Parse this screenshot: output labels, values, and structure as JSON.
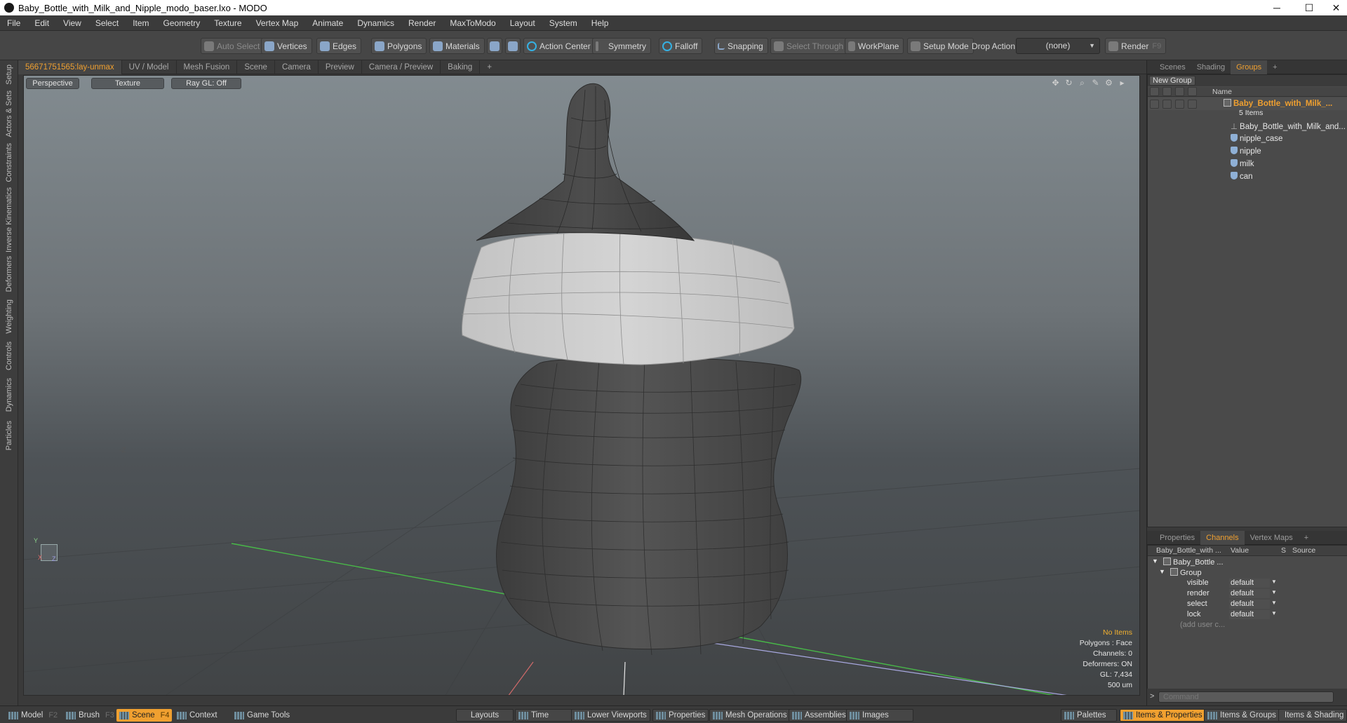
{
  "window": {
    "title": "Baby_Bottle_with_Milk_and_Nipple_modo_baser.lxo - MODO",
    "min": "─",
    "max": "☐",
    "close": "✕"
  },
  "menu": [
    "File",
    "Edit",
    "View",
    "Select",
    "Item",
    "Geometry",
    "Texture",
    "Vertex Map",
    "Animate",
    "Dynamics",
    "Render",
    "MaxToModo",
    "Layout",
    "System",
    "Help"
  ],
  "toolbar": {
    "auto_select": "Auto Select",
    "vertices": "Vertices",
    "edges": "Edges",
    "polygons": "Polygons",
    "materials": "Materials",
    "action_center": "Action Center",
    "symmetry": "Symmetry",
    "falloff": "Falloff",
    "snapping": "Snapping",
    "select_through": "Select Through",
    "workplane": "WorkPlane",
    "setup_mode": "Setup Mode",
    "drop_action": "Drop Action",
    "drop_value": "(none)",
    "render": "Render",
    "render_key": "F9"
  },
  "left_tabs": [
    "Setup",
    "Actors & Sets",
    "Constraints",
    "Inverse Kinematics",
    "Deformers",
    "Weighting",
    "Controls",
    "Dynamics",
    "Particles"
  ],
  "viewport_tabs": [
    "56671751565:lay-unmax",
    "UV / Model",
    "Mesh Fusion",
    "Scene",
    "Camera",
    "Preview",
    "Camera / Preview",
    "Baking",
    "+"
  ],
  "viewport": {
    "view": "Perspective",
    "shading": "Texture",
    "raygl": "Ray GL: Off",
    "axis_y": "Y",
    "axis_z": "Z",
    "axis_x": "X",
    "minus_z": "-Z",
    "info": {
      "items": "No Items",
      "polygons": "Polygons : Face",
      "channels": "Channels: 0",
      "deformers": "Deformers: ON",
      "gl": "GL: 7,434",
      "unit": "500 um"
    }
  },
  "groups_panel": {
    "tabs": [
      "Scenes",
      "Shading",
      "Groups",
      "+"
    ],
    "new_group": "New Group",
    "col_name": "Name",
    "root": "Baby_Bottle_with_Milk_...",
    "root_count": "5 Items",
    "children": [
      "Baby_Bottle_with_Milk_and...",
      "nipple_case",
      "nipple",
      "milk",
      "can"
    ]
  },
  "channels_panel": {
    "tabs": [
      "Properties",
      "Channels",
      "Vertex Maps",
      "+"
    ],
    "cols": {
      "name": "Baby_Bottle_with ...",
      "value": "Value",
      "s": "S",
      "source": "Source"
    },
    "item": "Baby_Bottle ...",
    "group": "Group",
    "rows": [
      {
        "name": "visible",
        "value": "default"
      },
      {
        "name": "render",
        "value": "default"
      },
      {
        "name": "select",
        "value": "default"
      },
      {
        "name": "lock",
        "value": "default"
      }
    ],
    "add_user": "(add user c...",
    "command_placeholder": "Command"
  },
  "statusbar": {
    "model": "Model",
    "model_key": "F2",
    "brush": "Brush",
    "brush_key": "F3",
    "scene": "Scene",
    "scene_key": "F4",
    "context": "Context",
    "game_tools": "Game Tools",
    "layouts": "Layouts",
    "time": "Time",
    "lower_viewports": "Lower Viewports",
    "properties": "Properties",
    "mesh_operations": "Mesh Operations",
    "assemblies": "Assemblies",
    "images": "Images",
    "palettes": "Palettes",
    "items_properties": "Items & Properties",
    "items_groups": "Items & Groups",
    "items_shading": "Items & Shading"
  },
  "colors": {
    "accent": "#f0a030",
    "viewport_top": "#828b90",
    "viewport_bottom": "#414446",
    "mesh_dark": "#4b4b4b",
    "mesh_light": "#c9c9c9"
  }
}
